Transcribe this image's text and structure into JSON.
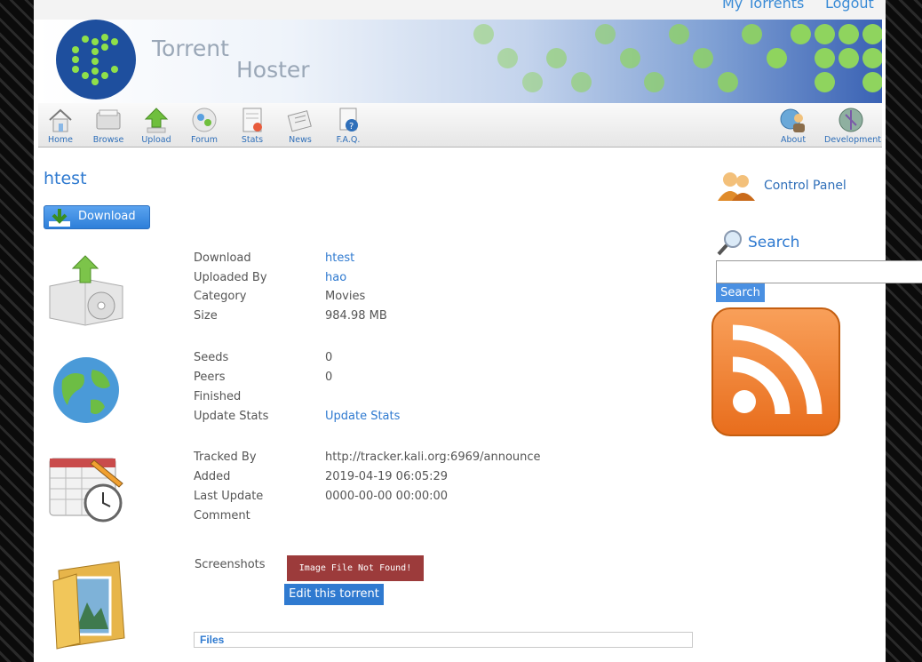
{
  "header": {
    "links": [
      "My Torrents",
      "Logout"
    ],
    "logo": {
      "word1": "Torrent",
      "word2": "Hoster"
    }
  },
  "nav": {
    "left": [
      {
        "label": "Home",
        "icon": "home-icon"
      },
      {
        "label": "Browse",
        "icon": "browse-icon"
      },
      {
        "label": "Upload",
        "icon": "upload-icon"
      },
      {
        "label": "Forum",
        "icon": "forum-icon"
      },
      {
        "label": "Stats",
        "icon": "stats-icon"
      },
      {
        "label": "News",
        "icon": "news-icon"
      },
      {
        "label": "F.A.Q.",
        "icon": "faq-icon"
      }
    ],
    "right": [
      {
        "label": "About",
        "icon": "about-icon"
      },
      {
        "label": "Development",
        "icon": "development-icon"
      }
    ]
  },
  "torrent": {
    "title": "htest",
    "download_button": "Download",
    "details": [
      {
        "label": "Download",
        "value": "htest",
        "link": true
      },
      {
        "label": "Uploaded By",
        "value": "hao",
        "link": true
      },
      {
        "label": "Category",
        "value": "Movies",
        "link": false
      },
      {
        "label": "Size",
        "value": "984.98 MB",
        "link": false
      }
    ],
    "stats": [
      {
        "label": "Seeds",
        "value": "0",
        "link": false
      },
      {
        "label": "Peers",
        "value": "0",
        "link": false
      },
      {
        "label": "Finished",
        "value": "",
        "link": false
      },
      {
        "label": "Update Stats",
        "value": "Update Stats",
        "link": true
      }
    ],
    "tracking": [
      {
        "label": "Tracked By",
        "value": "http://tracker.kali.org:6969/announce",
        "link": false
      },
      {
        "label": "Added",
        "value": "2019-04-19 06:05:29",
        "link": false
      },
      {
        "label": "Last Update",
        "value": "0000-00-00 00:00:00",
        "link": false
      },
      {
        "label": "Comment",
        "value": "",
        "link": false
      }
    ],
    "screenshots_label": "Screenshots",
    "image_not_found": "Image File Not Found!",
    "edit_button": "Edit this torrent",
    "files_label": "Files"
  },
  "sidebar": {
    "control_panel": "Control Panel",
    "search_heading": "Search",
    "search_value": "",
    "search_button": "Search",
    "rss_icon": "rss-icon"
  },
  "colors": {
    "accent": "#2f7ad0",
    "rss": "#f0842c",
    "banner_dots": "#6fcf45"
  }
}
